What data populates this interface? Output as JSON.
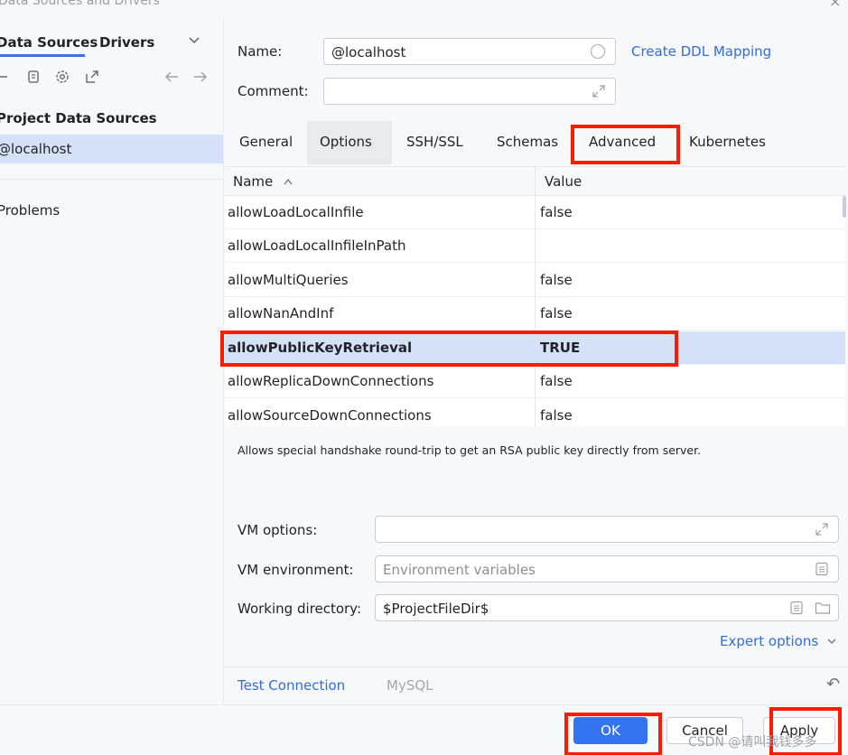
{
  "window": {
    "title": "Data Sources and Drivers",
    "close_glyph": "×"
  },
  "left_panel": {
    "tabs": [
      "Data Sources",
      "Drivers"
    ],
    "active_tab": "Data Sources",
    "section_header": "Project Data Sources",
    "data_sources": [
      "@localhost"
    ],
    "problems_label": "Problems",
    "tool_icons": [
      "minus-icon",
      "copy-icon",
      "settings-icon",
      "jump-to-icon",
      "back-arrow-icon",
      "forward-arrow-icon"
    ]
  },
  "form": {
    "name_label": "Name:",
    "name_value": "@localhost",
    "create_ddl_link": "Create DDL Mapping",
    "comment_label": "Comment:",
    "comment_value": "",
    "tabs": [
      "General",
      "Options",
      "SSH/SSL",
      "Schemas",
      "Advanced",
      "Kubernetes"
    ],
    "active_tab": "Options",
    "highlighted_tab": "Advanced"
  },
  "properties_table": {
    "columns": [
      "Name",
      "Value"
    ],
    "sort_indicator": "^",
    "rows": [
      {
        "name": "allowLoadLocalInfile",
        "value": "false"
      },
      {
        "name": "allowLoadLocalInfileInPath",
        "value": ""
      },
      {
        "name": "allowMultiQueries",
        "value": "false"
      },
      {
        "name": "allowNanAndInf",
        "value": "false"
      },
      {
        "name": "allowPublicKeyRetrieval",
        "value": "TRUE"
      },
      {
        "name": "allowReplicaDownConnections",
        "value": "false"
      },
      {
        "name": "allowSourceDownConnections",
        "value": "false"
      }
    ],
    "selected_row": "allowPublicKeyRetrieval"
  },
  "description": "Allows special handshake round-trip to get an RSA public key directly from server.",
  "vm": {
    "vm_options_label": "VM options:",
    "vm_options_value": "",
    "vm_environment_label": "VM environment:",
    "vm_environment_placeholder": "Environment variables",
    "working_directory_label": "Working directory:",
    "working_directory_value": "$ProjectFileDir$",
    "expert_options_link": "Expert options"
  },
  "footer": {
    "test_connection_link": "Test Connection",
    "driver_label": "MySQL",
    "revert_glyph": "↶"
  },
  "buttons": {
    "ok": "OK",
    "cancel": "Cancel",
    "apply": "Apply"
  },
  "watermark": "CSDN @请叫我钱多多",
  "colors": {
    "accent": "#3574f0",
    "link": "#2f6de0",
    "selection": "#d5e1f8",
    "annotation_red": "#ff1a00"
  }
}
